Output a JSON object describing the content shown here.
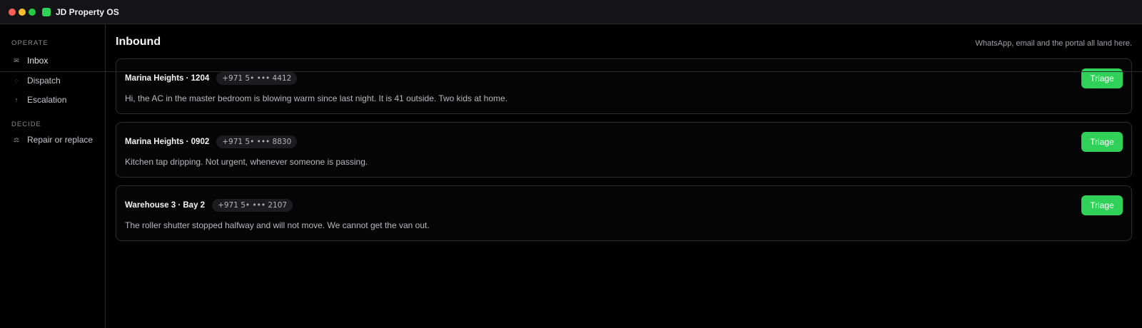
{
  "window": {
    "title": "JD Property OS"
  },
  "sidebar": {
    "sections": [
      {
        "label": "OPERATE"
      },
      {
        "label": "DECIDE"
      }
    ],
    "items": [
      {
        "label": "Inbox",
        "icon": "mail-icon",
        "glyph": "✉"
      },
      {
        "label": "Dispatch",
        "icon": "dispatch-icon",
        "glyph": "◌"
      },
      {
        "label": "Escalation",
        "icon": "arrow-up-icon",
        "glyph": "↑"
      },
      {
        "label": "Repair or replace",
        "icon": "scale-icon",
        "glyph": "⚖"
      }
    ]
  },
  "main": {
    "title": "Inbound",
    "subtitle": "WhatsApp, email and the portal all land here.",
    "messages": [
      {
        "title": "Marina Heights · 1204",
        "phone": "+971 5• ••• 4412",
        "text": "Hi, the AC in the master bedroom is blowing warm since last night. It is 41 outside. Two kids at home.",
        "action": "Triage"
      },
      {
        "title": "Marina Heights · 0902",
        "phone": "+971 5• ••• 8830",
        "text": "Kitchen tap dripping. Not urgent, whenever someone is passing.",
        "action": "Triage"
      },
      {
        "title": "Warehouse 3 · Bay 2",
        "phone": "+971 5• ••• 2107",
        "text": "The roller shutter stopped halfway and will not move. We cannot get the van out.",
        "action": "Triage"
      }
    ]
  },
  "colors": {
    "accent": "#30d158",
    "background": "#000000"
  }
}
